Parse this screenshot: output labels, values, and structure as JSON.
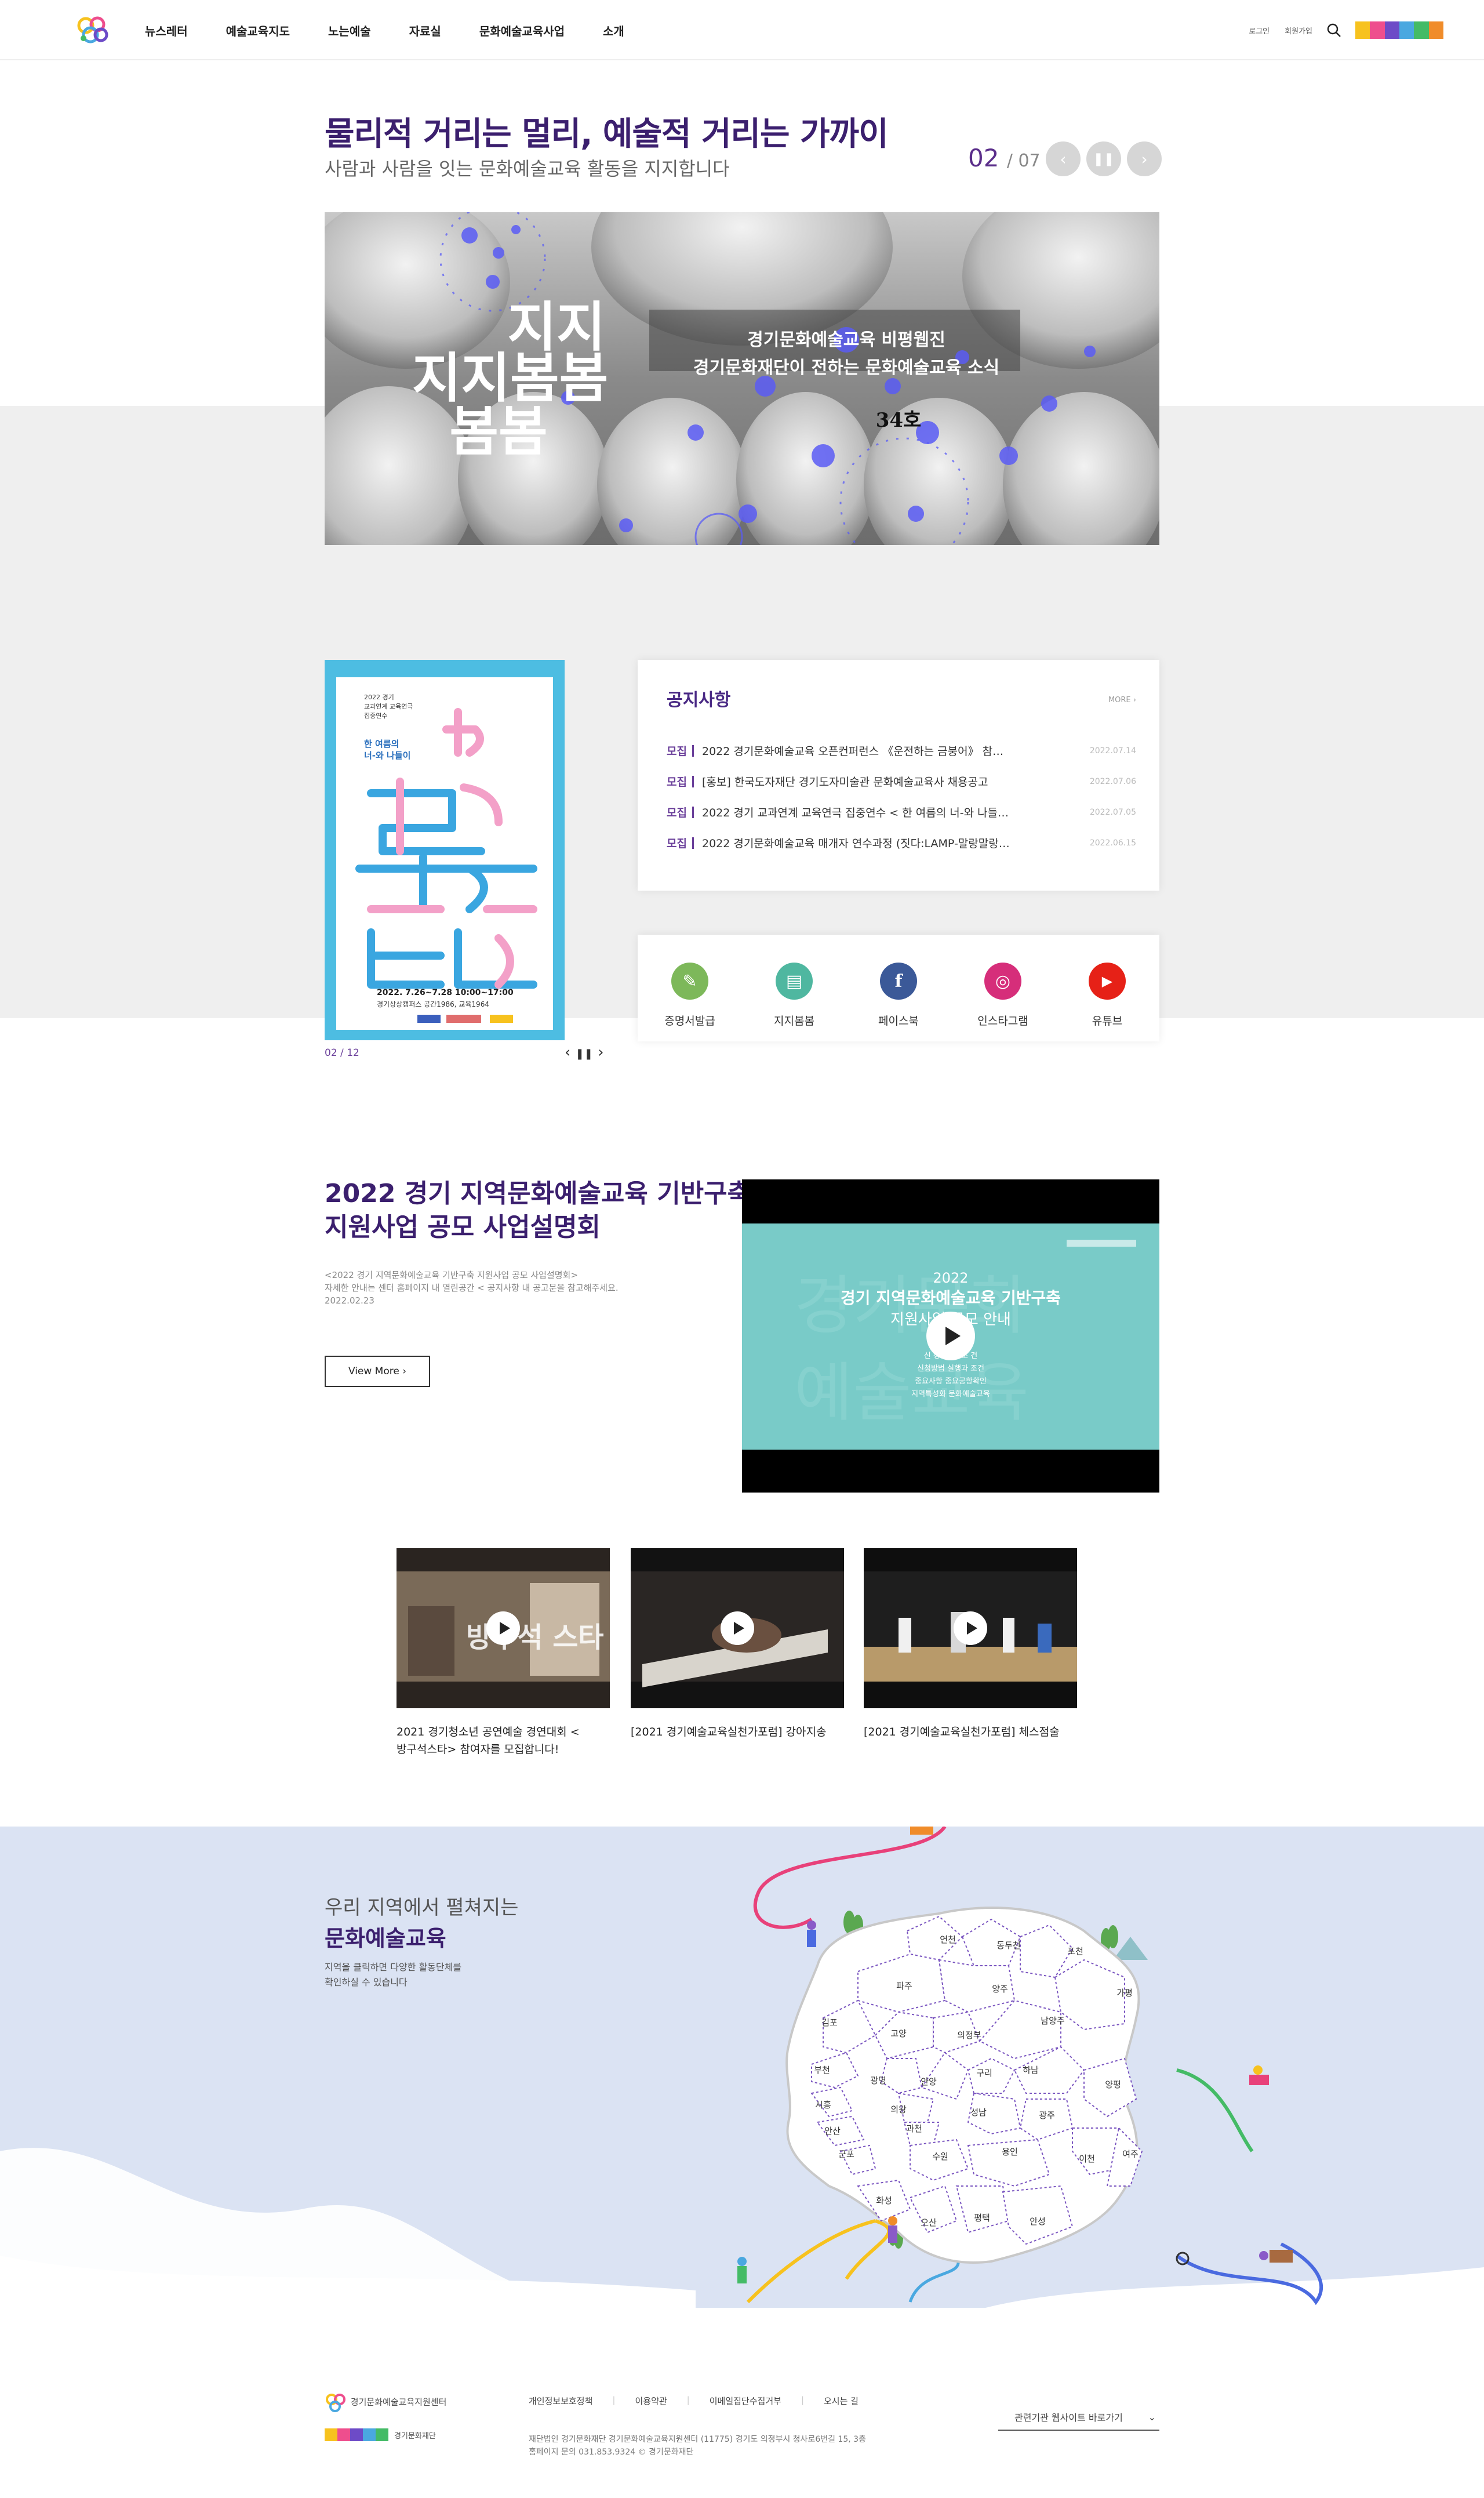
{
  "header": {
    "nav": [
      "뉴스레터",
      "예술교육지도",
      "노는예술",
      "자료실",
      "문화예술교육사업",
      "소개"
    ],
    "login": "로그인",
    "signup": "회원가입",
    "rainbow_colors": [
      "#f7c21e",
      "#ee4e8d",
      "#6d4bc7",
      "#4aa8e0",
      "#44bb66",
      "#f08c2a"
    ]
  },
  "hero": {
    "title": "물리적 거리는 멀리, 예술적 거리는 가까이",
    "subtitle": "사람과 사람을 잇는 문화예술교육 활동을 지지합니다",
    "current": "02",
    "total": "07",
    "banner": {
      "big1": "지지",
      "big2": "지지봄봄",
      "big3": "봄봄",
      "line1": "경기문화예술교육 비평웹진",
      "line2": "경기문화재단이 전하는 문화예술교육 소식",
      "issue": "34호"
    }
  },
  "poster": {
    "small_lines": [
      "2022 경기",
      "교과연계 교육연극",
      "집중연수"
    ],
    "tagline": "한 여름의",
    "tagline2": "너-와 나들이",
    "big1": "한",
    "big2": "여름의",
    "big3": "너-와",
    "big4": "나들이",
    "date": "2022. 7.26~7.28  10:00~17:00",
    "venue": "경기상상캠퍼스 공간1986, 교육1964",
    "pager_current": "02",
    "pager_total": "12"
  },
  "notice": {
    "title": "공지사항",
    "more": "MORE",
    "items": [
      {
        "tag": "모집",
        "text": "2022 경기문화예술교육 오픈컨퍼런스 《운전하는 금붕어》 참…",
        "date": "2022.07.14"
      },
      {
        "tag": "모집",
        "text": "[홍보] 한국도자재단 경기도자미술관 문화예술교육사 채용공고",
        "date": "2022.07.06"
      },
      {
        "tag": "모집",
        "text": "2022 경기 교과연계 교육연극 집중연수 < 한 여름의 너-와 나들…",
        "date": "2022.07.05"
      },
      {
        "tag": "모집",
        "text": "2022 경기문화예술교육 매개자 연수과정 (짓다:LAMP-말랑말랑…",
        "date": "2022.06.15"
      }
    ]
  },
  "sns": [
    {
      "label": "증명서발급",
      "icon": "certificate-icon",
      "color": "#7db85a",
      "glyph": "✎"
    },
    {
      "label": "지지봄봄",
      "icon": "webzine-icon",
      "color": "#4fb7a0",
      "glyph": "▤"
    },
    {
      "label": "페이스북",
      "icon": "facebook-icon",
      "color": "#3b5998",
      "glyph": "f"
    },
    {
      "label": "인스타그램",
      "icon": "instagram-icon",
      "color": "#d62e7a",
      "glyph": "◎"
    },
    {
      "label": "유튜브",
      "icon": "youtube-icon",
      "color": "#e62117",
      "glyph": "▶"
    }
  ],
  "video": {
    "title_line1": "2022 경기 지역문화예술교육 기반구축",
    "title_line2": "지원사업 공모 사업설명회",
    "desc_line1": "<2022 경기 지역문화예술교육 기반구축 지원사업 공모 사업설명회>",
    "desc_line2": "자세한 안내는 센터 홈페이지 내 열린공간 < 공지사항 내 공고문을 참고해주세요.",
    "date": "2022.02.23",
    "view_more": "View More",
    "screen_year": "2022",
    "screen_title": "경기 지역문화예술교육 기반구축",
    "screen_sub": "지원사업 공모 안내",
    "screen_lines": [
      "신 청 자 격 조 건",
      "신청방법 실행과 조건",
      "중요사항 중요공항확인",
      "지역특성화 문화예술교육"
    ]
  },
  "thumbs": [
    {
      "caption_line1": "2021 경기청소년 공연예술 경연대회 <",
      "caption_line2": "방구석스타> 참여자를 모집합니다!",
      "screen_text": "방구석 스타"
    },
    {
      "caption_line1": "[2021 경기예술교육실천가포럼] 강아지송",
      "caption_line2": "",
      "screen_text": ""
    },
    {
      "caption_line1": "[2021 경기예술교육실천가포럼] 체스점술",
      "caption_line2": "",
      "screen_text": ""
    }
  ],
  "map": {
    "sub": "우리 지역에서 펼쳐지는",
    "title": "문화예술교육",
    "desc_line1": "지역을 클릭하면 다양한 활동단체를",
    "desc_line2": "확인하실 수 있습니다",
    "regions": [
      "연천",
      "동두천",
      "포천",
      "파주",
      "양주",
      "가평",
      "김포",
      "고양",
      "의정부",
      "남양주",
      "부천",
      "광명",
      "안양",
      "구리",
      "하남",
      "양평",
      "시흥",
      "의왕",
      "성남",
      "광주",
      "안산",
      "과천",
      "군포",
      "수원",
      "용인",
      "이천",
      "여주",
      "화성",
      "오산",
      "평택",
      "안성"
    ]
  },
  "footer": {
    "logo_text": "경기문화예술교육지원센터",
    "logo2_text": "경기문화재단",
    "links": [
      "개인정보보호정책",
      "이용약관",
      "이메일집단수집거부",
      "오시는 길"
    ],
    "addr_line1": "재단법인 경기문화재단 경기문화예술교육지원센터 (11775) 경기도 의정부시 청사로6번길 15, 3층",
    "addr_line2": "홈페이지 문의 031.853.9324 © 경기문화재단",
    "family_site": "관련기관 웹사이트 바로가기"
  }
}
